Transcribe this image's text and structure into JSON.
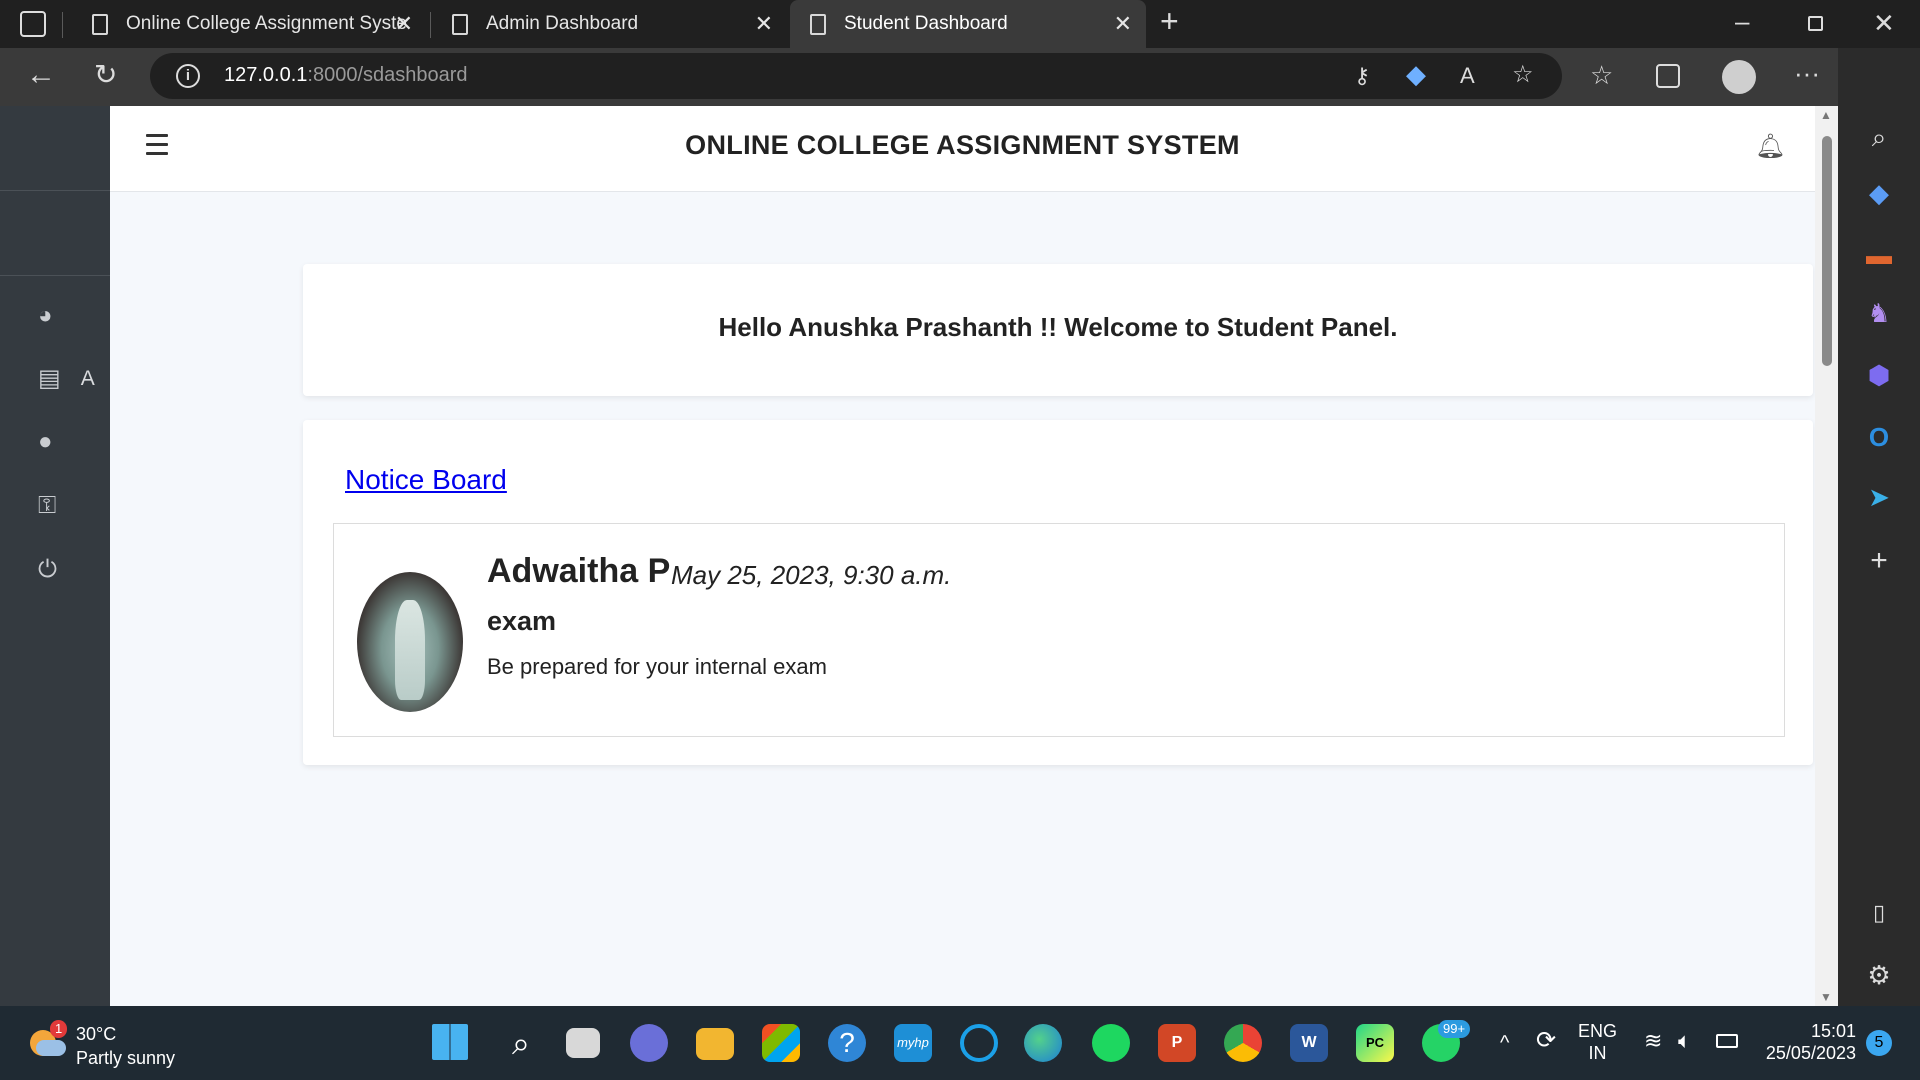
{
  "browser": {
    "tabs": [
      {
        "label": "Online College Assignment Syste",
        "active": false
      },
      {
        "label": "Admin Dashboard",
        "active": false
      },
      {
        "label": "Student Dashboard",
        "active": true
      }
    ],
    "url_host": "127.0.0.1",
    "url_path": ":8000/sdashboard"
  },
  "page": {
    "site_title": "ONLINE COLLEGE ASSIGNMENT SYSTEM",
    "welcome_message": "Hello Anushka Prashanth !! Welcome to Student Panel.",
    "sidebar": {
      "items": [
        {
          "icon": "dashboard-icon"
        },
        {
          "icon": "upload-file-icon",
          "label": "A"
        },
        {
          "icon": "user-icon"
        },
        {
          "icon": "key-icon"
        },
        {
          "icon": "power-icon"
        }
      ]
    },
    "notice_board": {
      "title": "Notice Board",
      "notices": [
        {
          "author": "Adwaitha P",
          "date": "May 25, 2023, 9:30 a.m.",
          "subject": "exam",
          "body": "Be prepared for your internal exam"
        }
      ]
    }
  },
  "taskbar": {
    "weather": {
      "temp": "30°C",
      "condition": "Partly sunny",
      "badge": "1"
    },
    "whatsapp_badge": "99+",
    "language": {
      "line1": "ENG",
      "line2": "IN"
    },
    "time": "15:01",
    "date": "25/05/2023",
    "notifications": "5"
  },
  "colors": {
    "sidebar_bg": "#343a40",
    "link": "#0000ee",
    "page_bg": "#f5f8fc"
  }
}
